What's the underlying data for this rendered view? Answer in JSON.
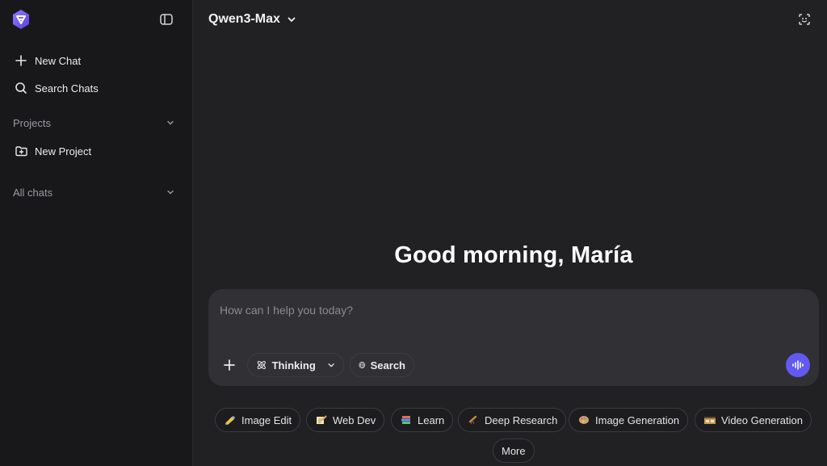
{
  "sidebar": {
    "new_chat": "New Chat",
    "search_chats": "Search Chats",
    "projects_header": "Projects",
    "new_project": "New Project",
    "all_chats_header": "All chats"
  },
  "header": {
    "model": "Qwen3-Max"
  },
  "main": {
    "greeting": "Good morning, María"
  },
  "composer": {
    "placeholder": "How can I help you today?",
    "thinking_label": "Thinking",
    "search_label": "Search"
  },
  "suggestions": [
    {
      "label": "Image Edit",
      "icon": "paint-icon"
    },
    {
      "label": "Web Dev",
      "icon": "notepad-icon"
    },
    {
      "label": "Learn",
      "icon": "books-icon"
    },
    {
      "label": "Deep Research",
      "icon": "telescope-icon"
    },
    {
      "label": "Image Generation",
      "icon": "palette-icon"
    },
    {
      "label": "Video Generation",
      "icon": "film-icon"
    }
  ],
  "more_label": "More",
  "colors": {
    "accent": "#6259f0",
    "sidebar_bg": "#18181b",
    "main_bg": "#212124",
    "composer_bg": "#303035"
  }
}
